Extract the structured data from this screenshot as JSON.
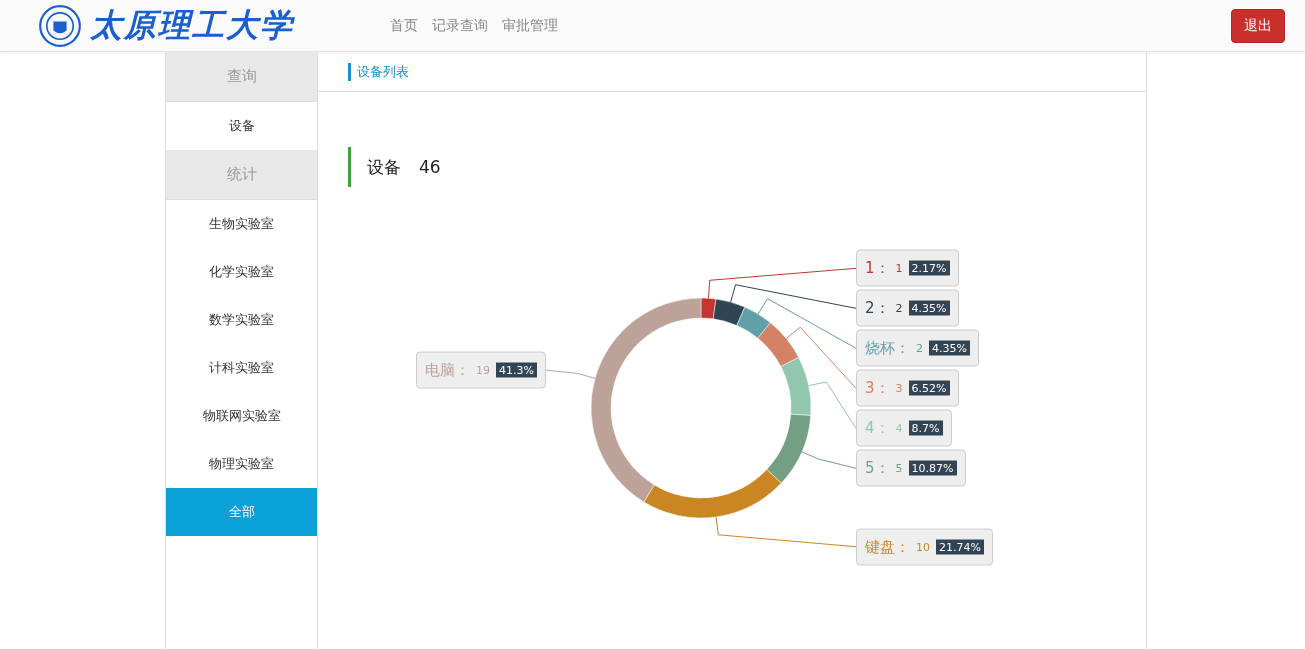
{
  "header": {
    "logo_text": "太原理工大学",
    "nav": [
      {
        "label": "首页",
        "selected": false
      },
      {
        "label": "记录查询",
        "selected": false
      },
      {
        "label": "审批管理",
        "selected": false
      }
    ],
    "logout": "退出"
  },
  "sidebar": [
    {
      "kind": "header",
      "label": "查询"
    },
    {
      "kind": "item",
      "label": "设备",
      "selected": false
    },
    {
      "kind": "header",
      "label": "统计"
    },
    {
      "kind": "item",
      "label": "生物实验室",
      "selected": false
    },
    {
      "kind": "item",
      "label": "化学实验室",
      "selected": false
    },
    {
      "kind": "item",
      "label": "数学实验室",
      "selected": false
    },
    {
      "kind": "item",
      "label": "计科实验室",
      "selected": false
    },
    {
      "kind": "item",
      "label": "物联网实验室",
      "selected": false
    },
    {
      "kind": "item",
      "label": "物理实验室",
      "selected": false
    },
    {
      "kind": "item",
      "label": "全部",
      "selected": true
    }
  ],
  "main": {
    "breadcrumb": "设备列表",
    "heading": "设备",
    "total": "46",
    "chart_data": {
      "type": "donut",
      "values": [
        2.17,
        4.35,
        4.35,
        6.52,
        8.7,
        10.87,
        21.74,
        41.3
      ],
      "colors": [
        "#c23531",
        "#2f4554",
        "#61a0a8",
        "#d48265",
        "#91c7ae",
        "#749f83",
        "#ca8622",
        "#bda29a"
      ]
    },
    "slice_labels": [
      {
        "name": "1：",
        "count": "1",
        "share": "2.17%"
      },
      {
        "name": "2：",
        "count": "2",
        "share": "4.35%"
      },
      {
        "name": "烧杯：",
        "count": "2",
        "share": "4.35%"
      },
      {
        "name": "3：",
        "count": "3",
        "share": "6.52%"
      },
      {
        "name": "4：",
        "count": "4",
        "share": "8.7%"
      },
      {
        "name": "5：",
        "count": "5",
        "share": "10.87%"
      },
      {
        "name": "键盘：",
        "count": "10",
        "share": "21.74%"
      },
      {
        "name": "电脑：",
        "count": "19",
        "share": "41.3%"
      }
    ]
  }
}
